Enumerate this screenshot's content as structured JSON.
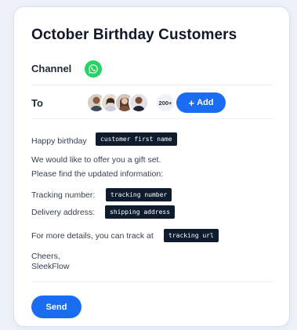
{
  "title": "October Birthday Customers",
  "channel": {
    "label": "Channel",
    "icon": "whatsapp-icon",
    "color": "#25d366"
  },
  "recipients": {
    "label": "To",
    "avatar_count": "200+",
    "add_label": "Add",
    "add_icon": "plus-icon"
  },
  "message": {
    "greeting": "Happy birthday",
    "var_first_name": "customer first name",
    "line_offer": "We would like to offer you a gift set.",
    "line_info": "Please find the updated information:",
    "tracking_label": "Tracking number:",
    "var_tracking_number": "tracking number",
    "delivery_label": "Delivery address:",
    "var_shipping_address": "shipping address",
    "details_text": "For more details, you can track at",
    "var_tracking_url": "tracking url",
    "signoff_1": "Cheers,",
    "signoff_2": "SleekFlow"
  },
  "send_label": "Send",
  "colors": {
    "accent": "#1a6cf0",
    "variable_bg": "#0f1c2e"
  }
}
